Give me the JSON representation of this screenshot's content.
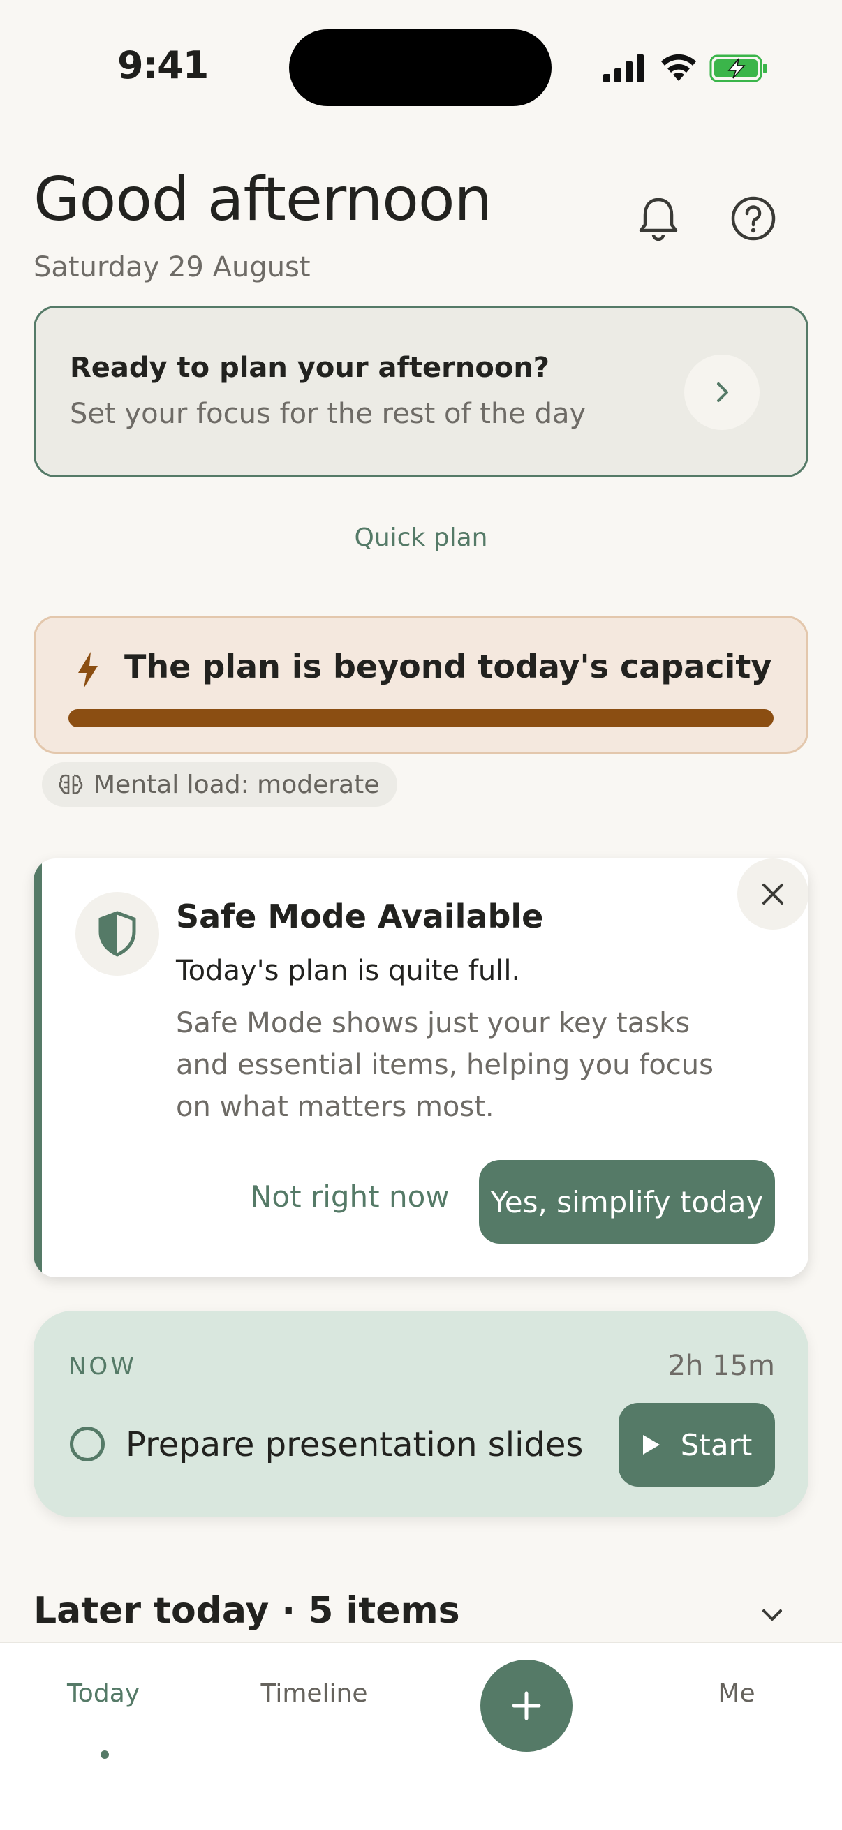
{
  "status_bar": {
    "time": "9:41"
  },
  "header": {
    "greeting": "Good afternoon",
    "date": "Saturday 29 August"
  },
  "plan_card": {
    "title": "Ready to plan your afternoon?",
    "subtitle": "Set your focus for the rest of the day"
  },
  "quick_plan_label": "Quick plan",
  "capacity": {
    "text": "The plan is beyond today's capacity",
    "load_label": "Mental load: moderate",
    "bar_fill": 1.0,
    "color": "#8b4e12"
  },
  "safe_mode": {
    "title": "Safe Mode Available",
    "lead": "Today's plan is quite full.",
    "body": "Safe Mode shows just your key tasks and essential items, helping you focus on what matters most.",
    "dismiss_label": "Not right now",
    "confirm_label": "Yes, simplify today"
  },
  "now": {
    "label": "NOW",
    "duration": "2h 15m",
    "task": "Prepare presentation slides",
    "start_label": "Start"
  },
  "later": {
    "heading": "Later today · 5 items"
  },
  "nav": {
    "today": "Today",
    "timeline": "Timeline",
    "me": "Me"
  },
  "colors": {
    "accent": "#557a67",
    "background": "#f9f7f3",
    "warning_bg": "#f4e8de",
    "now_bg": "#d9e7de"
  },
  "icons": [
    "signal-icon",
    "wifi-icon",
    "battery-charging-icon",
    "bell-icon",
    "help-icon",
    "chevron-right-icon",
    "lightning-icon",
    "brain-icon",
    "shield-icon",
    "close-icon",
    "play-icon",
    "chevron-down-icon",
    "plus-icon"
  ]
}
